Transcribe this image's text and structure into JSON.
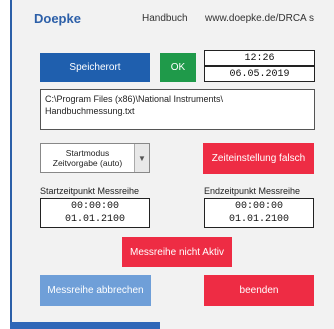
{
  "header": {
    "brand": "Doepke",
    "manual_link": "Handbuch",
    "url_link": "www.doepke.de/DRCA s"
  },
  "controls": {
    "save_button": "Speicherort",
    "ok_indicator": "OK",
    "time": "12:26",
    "date": "06.05.2019",
    "path_line1": "C:\\Program Files (x86)\\National Instruments\\",
    "path_line2": "Handbuchmessung.txt",
    "start_mode_line1": "Startmodus",
    "start_mode_line2": "Zeitvorgabe (auto)",
    "time_setting_button": "Zeiteinstellung falsch",
    "start_label": "Startzeitpunkt Messreihe",
    "start_time": "00:00:00",
    "start_date": "01.01.2100",
    "end_label": "Endzeitpunkt Messreihe",
    "end_time": "00:00:00",
    "end_date": "01.01.2100",
    "series_status_button": "Messreihe nicht Aktiv",
    "cancel_series_button": "Messreihe abbrechen",
    "quit_button": "beenden"
  },
  "colors": {
    "blue": "#1f5fae",
    "green": "#1f9a4a",
    "red": "#ee2c44",
    "light_blue": "#6f9fd8"
  }
}
